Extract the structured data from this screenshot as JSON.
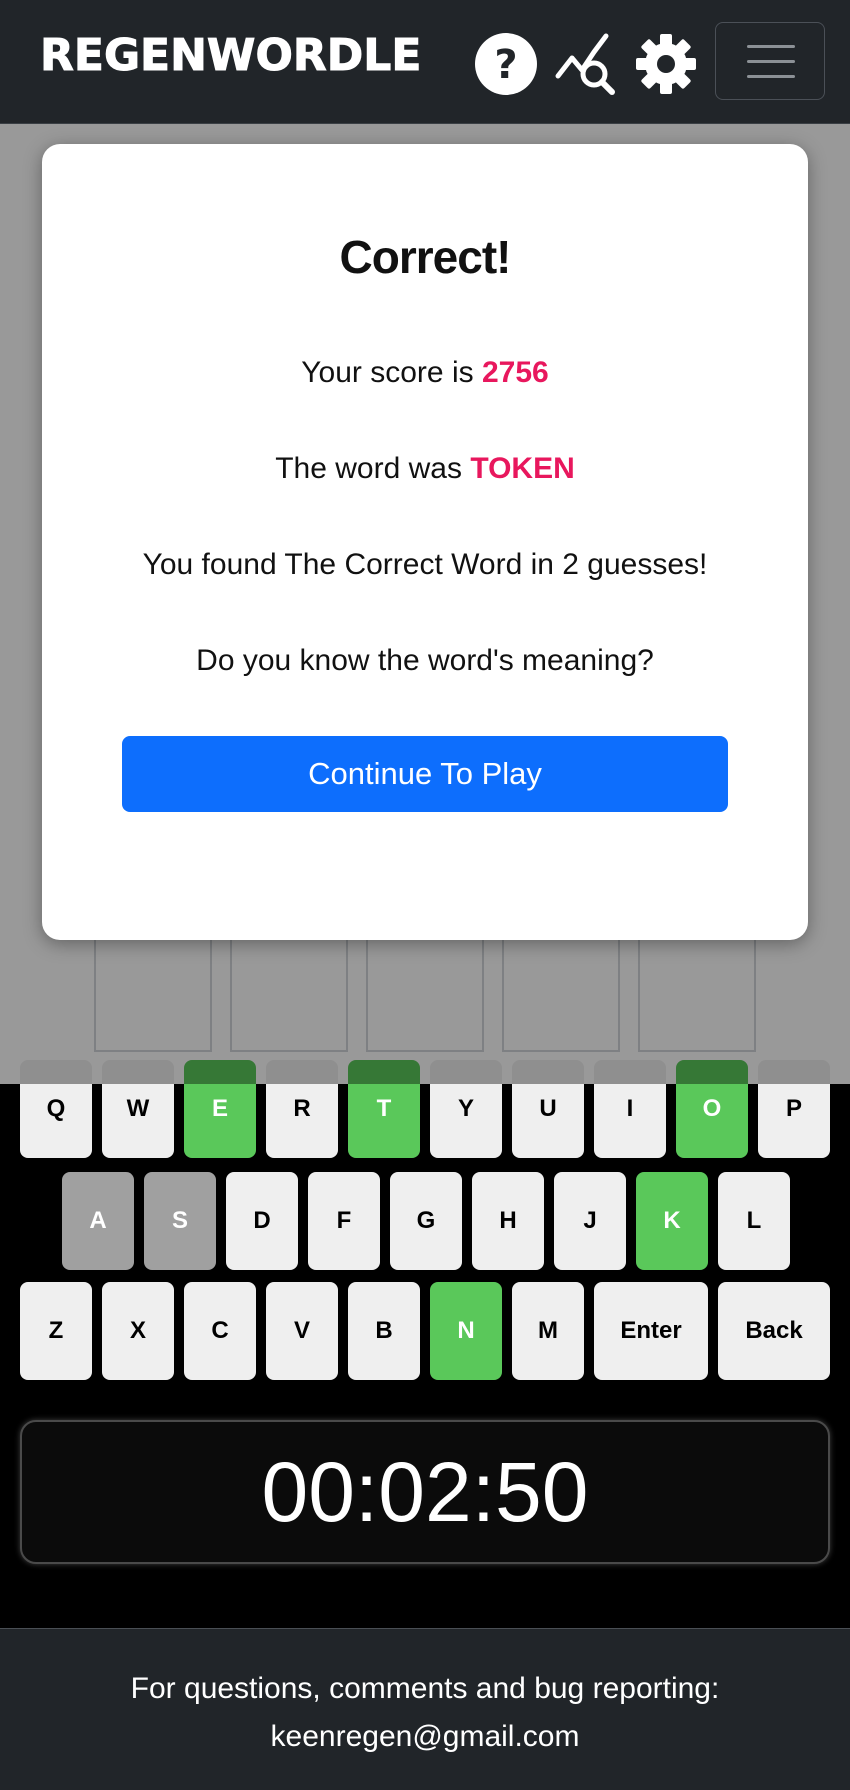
{
  "header": {
    "brand": "REGENWORDLE",
    "icons": [
      "help-icon",
      "stats-icon",
      "gear-icon",
      "menu-icon"
    ]
  },
  "keyboard": {
    "rows": [
      [
        {
          "label": "Q",
          "state": "unused"
        },
        {
          "label": "W",
          "state": "unused"
        },
        {
          "label": "E",
          "state": "correct"
        },
        {
          "label": "R",
          "state": "unused"
        },
        {
          "label": "T",
          "state": "correct"
        },
        {
          "label": "Y",
          "state": "unused"
        },
        {
          "label": "U",
          "state": "unused"
        },
        {
          "label": "I",
          "state": "unused"
        },
        {
          "label": "O",
          "state": "correct"
        },
        {
          "label": "P",
          "state": "unused"
        }
      ],
      [
        {
          "label": "A",
          "state": "absent"
        },
        {
          "label": "S",
          "state": "absent"
        },
        {
          "label": "D",
          "state": "unused"
        },
        {
          "label": "F",
          "state": "unused"
        },
        {
          "label": "G",
          "state": "unused"
        },
        {
          "label": "H",
          "state": "unused"
        },
        {
          "label": "J",
          "state": "unused"
        },
        {
          "label": "K",
          "state": "correct"
        },
        {
          "label": "L",
          "state": "unused"
        }
      ],
      [
        {
          "label": "Z",
          "state": "unused"
        },
        {
          "label": "X",
          "state": "unused"
        },
        {
          "label": "C",
          "state": "unused"
        },
        {
          "label": "V",
          "state": "unused"
        },
        {
          "label": "B",
          "state": "unused"
        },
        {
          "label": "N",
          "state": "correct"
        },
        {
          "label": "M",
          "state": "unused"
        },
        {
          "label": "Enter",
          "state": "unused"
        },
        {
          "label": "Back",
          "state": "unused"
        }
      ]
    ]
  },
  "timer": "00:02:50",
  "footer": {
    "line1": "For questions, comments and bug reporting:",
    "email": "keenregen@gmail.com"
  },
  "modal": {
    "title": "Correct!",
    "score_prefix": "Your score is",
    "score": "2756",
    "word_prefix": "The word was",
    "word": "TOKEN",
    "found_text": "You found The Correct Word in 2 guesses!",
    "meaning_question": "Do you know the word's meaning?",
    "continue_label": "Continue To Play"
  },
  "colors": {
    "correct": "#5ac85a",
    "absent": "#a0a0a0",
    "accent": "#e8175d",
    "button": "#0d6efd",
    "header": "#212529"
  }
}
